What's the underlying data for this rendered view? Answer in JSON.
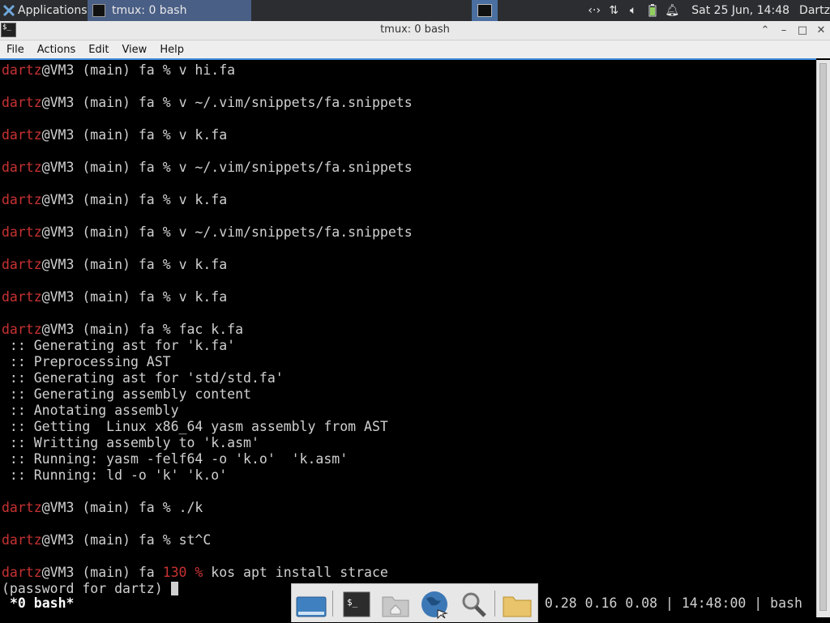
{
  "panel": {
    "apps_label": "Applications",
    "task_label": "tmux: 0 bash",
    "clock": "Sat 25 Jun, 14:48",
    "user": "Dartz",
    "tray_icons": [
      "network-arrows-icon",
      "updown-arrows-icon",
      "volume-icon",
      "battery-icon",
      "bell-icon"
    ]
  },
  "window": {
    "title": "tmux: 0 bash",
    "controls": [
      "maximize-up",
      "minimize",
      "restore",
      "close"
    ]
  },
  "menubar": {
    "file": "File",
    "actions": "Actions",
    "edit": "Edit",
    "view": "View",
    "help": "Help"
  },
  "terminal": {
    "user": "dartz",
    "prompt_host": "@VM3 (main) fa",
    "lines": [
      {
        "kind": "prompt",
        "cmd": "v hi.fa"
      },
      {
        "kind": "blank"
      },
      {
        "kind": "prompt",
        "cmd": "v ~/.vim/snippets/fa.snippets"
      },
      {
        "kind": "blank"
      },
      {
        "kind": "prompt",
        "cmd": "v k.fa"
      },
      {
        "kind": "blank"
      },
      {
        "kind": "prompt",
        "cmd": "v ~/.vim/snippets/fa.snippets"
      },
      {
        "kind": "blank"
      },
      {
        "kind": "prompt",
        "cmd": "v k.fa"
      },
      {
        "kind": "blank"
      },
      {
        "kind": "prompt",
        "cmd": "v ~/.vim/snippets/fa.snippets"
      },
      {
        "kind": "blank"
      },
      {
        "kind": "prompt",
        "cmd": "v k.fa"
      },
      {
        "kind": "blank"
      },
      {
        "kind": "prompt",
        "cmd": "v k.fa"
      },
      {
        "kind": "blank"
      },
      {
        "kind": "prompt",
        "cmd": "fac k.fa"
      },
      {
        "kind": "out",
        "text": " :: Generating ast for 'k.fa'"
      },
      {
        "kind": "out",
        "text": " :: Preprocessing AST"
      },
      {
        "kind": "out",
        "text": " :: Generating ast for 'std/std.fa'"
      },
      {
        "kind": "out",
        "text": " :: Generating assembly content"
      },
      {
        "kind": "out",
        "text": " :: Anotating assembly"
      },
      {
        "kind": "out",
        "text": " :: Getting  Linux x86_64 yasm assembly from AST"
      },
      {
        "kind": "out",
        "text": " :: Writting assembly to 'k.asm'"
      },
      {
        "kind": "out",
        "text": " :: Running: yasm -felf64 -o 'k.o'  'k.asm'"
      },
      {
        "kind": "out",
        "text": " :: Running: ld -o 'k' 'k.o'"
      },
      {
        "kind": "blank"
      },
      {
        "kind": "prompt",
        "cmd": "./k"
      },
      {
        "kind": "blank"
      },
      {
        "kind": "prompt",
        "cmd": "st^C"
      },
      {
        "kind": "blank"
      },
      {
        "kind": "prompt_code",
        "code": "130 %",
        "cmd": "kos apt install strace"
      },
      {
        "kind": "password",
        "text": "(password for dartz) "
      }
    ]
  },
  "tmux": {
    "window_label": "*0 bash*",
    "status_right": "0.28 0.16 0.08 | 14:48:00 | bash"
  },
  "dock": {
    "items": [
      "show-desktop-icon",
      "terminal-icon",
      "home-folder-icon",
      "web-browser-icon",
      "search-icon",
      "files-icon"
    ]
  },
  "colors": {
    "panel_bg": "#2b2d30",
    "task_active": "#4a5f86",
    "prompt_user": "#c83232",
    "terminal_text": "#d0d0d0",
    "focus_border": "#3c8ad8"
  }
}
